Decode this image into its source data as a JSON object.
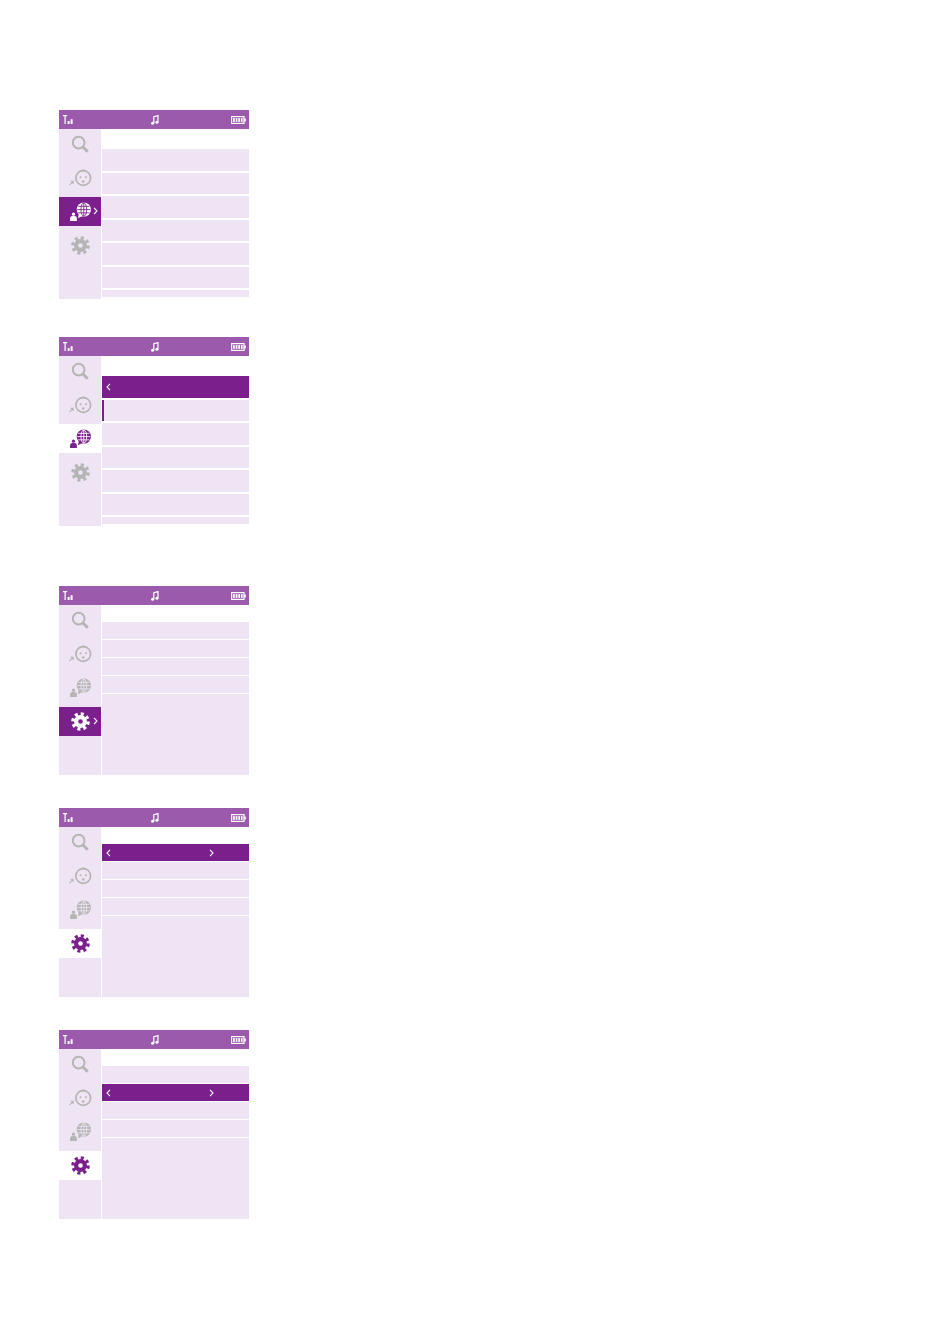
{
  "screens": [
    {
      "sidebar": {
        "focused": true,
        "items": [
          {
            "kind": "search",
            "selected": false
          },
          {
            "kind": "baby",
            "selected": false
          },
          {
            "kind": "globe",
            "selected": true
          },
          {
            "kind": "settings",
            "selected": false
          }
        ]
      },
      "list": {
        "rows": [
          {
            "selected": false,
            "left_arrow": false,
            "right_arrow": false
          },
          {
            "selected": false,
            "left_arrow": false,
            "right_arrow": false
          },
          {
            "selected": false,
            "left_arrow": false,
            "right_arrow": false
          },
          {
            "selected": false,
            "left_arrow": false,
            "right_arrow": false
          },
          {
            "selected": false,
            "left_arrow": false,
            "right_arrow": false
          },
          {
            "selected": false,
            "left_arrow": false,
            "right_arrow": false
          },
          {
            "selected": false,
            "left_arrow": false,
            "right_arrow": false
          }
        ]
      }
    },
    {
      "sidebar": {
        "focused": false,
        "items": [
          {
            "kind": "search",
            "selected": false
          },
          {
            "kind": "baby",
            "selected": false
          },
          {
            "kind": "globe",
            "selected": true
          },
          {
            "kind": "settings",
            "selected": false
          }
        ]
      },
      "list": {
        "rows": [
          {
            "selected": true,
            "left_arrow": true,
            "right_arrow": false,
            "cursor": false
          },
          {
            "selected": false,
            "left_arrow": false,
            "right_arrow": false,
            "cursor": true
          },
          {
            "selected": false,
            "left_arrow": false,
            "right_arrow": false,
            "cursor": false
          },
          {
            "selected": false,
            "left_arrow": false,
            "right_arrow": false,
            "cursor": false
          },
          {
            "selected": false,
            "left_arrow": false,
            "right_arrow": false,
            "cursor": false
          },
          {
            "selected": false,
            "left_arrow": false,
            "right_arrow": false,
            "cursor": false
          },
          {
            "selected": false,
            "left_arrow": false,
            "right_arrow": false,
            "cursor": false
          }
        ]
      }
    },
    {
      "sidebar": {
        "focused": true,
        "items": [
          {
            "kind": "search",
            "selected": false
          },
          {
            "kind": "baby",
            "selected": false
          },
          {
            "kind": "globe",
            "selected": false
          },
          {
            "kind": "settings",
            "selected": true
          }
        ]
      },
      "list": {
        "rows": [
          {
            "selected": false,
            "left_arrow": false,
            "right_arrow": false
          },
          {
            "selected": false,
            "left_arrow": false,
            "right_arrow": false
          },
          {
            "selected": false,
            "left_arrow": false,
            "right_arrow": false
          },
          {
            "selected": false,
            "left_arrow": false,
            "right_arrow": false
          }
        ]
      }
    },
    {
      "sidebar": {
        "focused": false,
        "items": [
          {
            "kind": "search",
            "selected": false
          },
          {
            "kind": "baby",
            "selected": false
          },
          {
            "kind": "globe",
            "selected": false
          },
          {
            "kind": "settings",
            "selected": true
          }
        ]
      },
      "list": {
        "rows": [
          {
            "selected": true,
            "left_arrow": true,
            "right_arrow": true
          },
          {
            "selected": false,
            "left_arrow": false,
            "right_arrow": false
          },
          {
            "selected": false,
            "left_arrow": false,
            "right_arrow": false
          },
          {
            "selected": false,
            "left_arrow": false,
            "right_arrow": false
          }
        ]
      }
    },
    {
      "sidebar": {
        "focused": false,
        "items": [
          {
            "kind": "search",
            "selected": false
          },
          {
            "kind": "baby",
            "selected": false
          },
          {
            "kind": "globe",
            "selected": false
          },
          {
            "kind": "settings",
            "selected": true
          }
        ]
      },
      "list": {
        "rows": [
          {
            "selected": false,
            "left_arrow": false,
            "right_arrow": false
          },
          {
            "selected": true,
            "left_arrow": true,
            "right_arrow": true
          },
          {
            "selected": false,
            "left_arrow": false,
            "right_arrow": false
          },
          {
            "selected": false,
            "left_arrow": false,
            "right_arrow": false
          }
        ]
      }
    }
  ]
}
